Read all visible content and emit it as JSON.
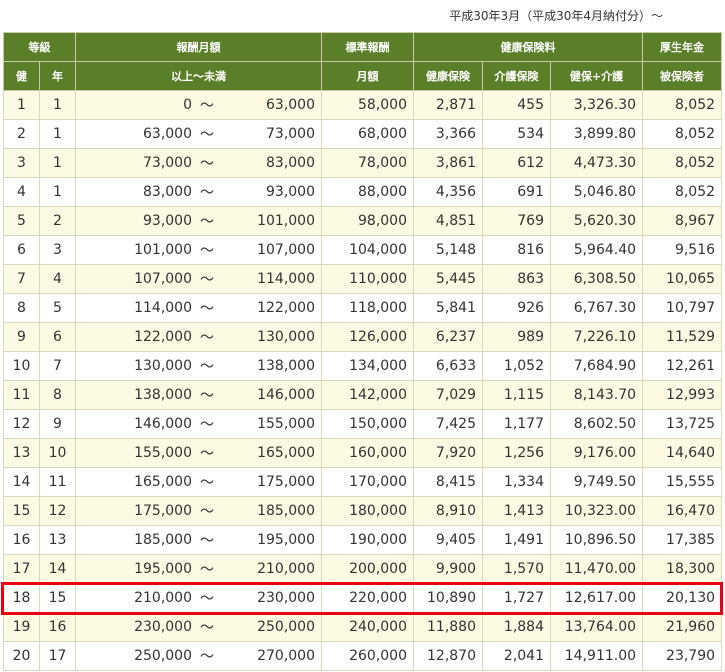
{
  "caption": "平成30年3月（平成30年4月納付分）～",
  "header": {
    "row1": {
      "grade": "等級",
      "monthly_pay": "報酬月額",
      "standard_pay": "標準報酬",
      "health_premium": "健康保険料",
      "pension": "厚生年金"
    },
    "row2": {
      "health": "健",
      "pension_grade": "年",
      "range": "以上～未満",
      "monthly": "月額",
      "health_ins": "健康保険",
      "care_ins": "介護保険",
      "health_plus_care": "健保+介護",
      "insured": "被保険者"
    }
  },
  "tilde": "～",
  "rows": [
    {
      "ken": "1",
      "nen": "1",
      "lo": "0",
      "hi": "63,000",
      "std": "58,000",
      "health": "2,871",
      "care": "455",
      "sum": "3,326.30",
      "pension": "8,052"
    },
    {
      "ken": "2",
      "nen": "1",
      "lo": "63,000",
      "hi": "73,000",
      "std": "68,000",
      "health": "3,366",
      "care": "534",
      "sum": "3,899.80",
      "pension": "8,052"
    },
    {
      "ken": "3",
      "nen": "1",
      "lo": "73,000",
      "hi": "83,000",
      "std": "78,000",
      "health": "3,861",
      "care": "612",
      "sum": "4,473.30",
      "pension": "8,052"
    },
    {
      "ken": "4",
      "nen": "1",
      "lo": "83,000",
      "hi": "93,000",
      "std": "88,000",
      "health": "4,356",
      "care": "691",
      "sum": "5,046.80",
      "pension": "8,052"
    },
    {
      "ken": "5",
      "nen": "2",
      "lo": "93,000",
      "hi": "101,000",
      "std": "98,000",
      "health": "4,851",
      "care": "769",
      "sum": "5,620.30",
      "pension": "8,967"
    },
    {
      "ken": "6",
      "nen": "3",
      "lo": "101,000",
      "hi": "107,000",
      "std": "104,000",
      "health": "5,148",
      "care": "816",
      "sum": "5,964.40",
      "pension": "9,516"
    },
    {
      "ken": "7",
      "nen": "4",
      "lo": "107,000",
      "hi": "114,000",
      "std": "110,000",
      "health": "5,445",
      "care": "863",
      "sum": "6,308.50",
      "pension": "10,065"
    },
    {
      "ken": "8",
      "nen": "5",
      "lo": "114,000",
      "hi": "122,000",
      "std": "118,000",
      "health": "5,841",
      "care": "926",
      "sum": "6,767.30",
      "pension": "10,797"
    },
    {
      "ken": "9",
      "nen": "6",
      "lo": "122,000",
      "hi": "130,000",
      "std": "126,000",
      "health": "6,237",
      "care": "989",
      "sum": "7,226.10",
      "pension": "11,529"
    },
    {
      "ken": "10",
      "nen": "7",
      "lo": "130,000",
      "hi": "138,000",
      "std": "134,000",
      "health": "6,633",
      "care": "1,052",
      "sum": "7,684.90",
      "pension": "12,261"
    },
    {
      "ken": "11",
      "nen": "8",
      "lo": "138,000",
      "hi": "146,000",
      "std": "142,000",
      "health": "7,029",
      "care": "1,115",
      "sum": "8,143.70",
      "pension": "12,993"
    },
    {
      "ken": "12",
      "nen": "9",
      "lo": "146,000",
      "hi": "155,000",
      "std": "150,000",
      "health": "7,425",
      "care": "1,177",
      "sum": "8,602.50",
      "pension": "13,725"
    },
    {
      "ken": "13",
      "nen": "10",
      "lo": "155,000",
      "hi": "165,000",
      "std": "160,000",
      "health": "7,920",
      "care": "1,256",
      "sum": "9,176.00",
      "pension": "14,640"
    },
    {
      "ken": "14",
      "nen": "11",
      "lo": "165,000",
      "hi": "175,000",
      "std": "170,000",
      "health": "8,415",
      "care": "1,334",
      "sum": "9,749.50",
      "pension": "15,555"
    },
    {
      "ken": "15",
      "nen": "12",
      "lo": "175,000",
      "hi": "185,000",
      "std": "180,000",
      "health": "8,910",
      "care": "1,413",
      "sum": "10,323.00",
      "pension": "16,470"
    },
    {
      "ken": "16",
      "nen": "13",
      "lo": "185,000",
      "hi": "195,000",
      "std": "190,000",
      "health": "9,405",
      "care": "1,491",
      "sum": "10,896.50",
      "pension": "17,385"
    },
    {
      "ken": "17",
      "nen": "14",
      "lo": "195,000",
      "hi": "210,000",
      "std": "200,000",
      "health": "9,900",
      "care": "1,570",
      "sum": "11,470.00",
      "pension": "18,300"
    },
    {
      "ken": "18",
      "nen": "15",
      "lo": "210,000",
      "hi": "230,000",
      "std": "220,000",
      "health": "10,890",
      "care": "1,727",
      "sum": "12,617.00",
      "pension": "20,130"
    },
    {
      "ken": "19",
      "nen": "16",
      "lo": "230,000",
      "hi": "250,000",
      "std": "240,000",
      "health": "11,880",
      "care": "1,884",
      "sum": "13,764.00",
      "pension": "21,960"
    },
    {
      "ken": "20",
      "nen": "17",
      "lo": "250,000",
      "hi": "270,000",
      "std": "260,000",
      "health": "12,870",
      "care": "2,041",
      "sum": "14,911.00",
      "pension": "23,790"
    }
  ],
  "highlight_color": "#e60012",
  "header_color": "#5b7f29"
}
